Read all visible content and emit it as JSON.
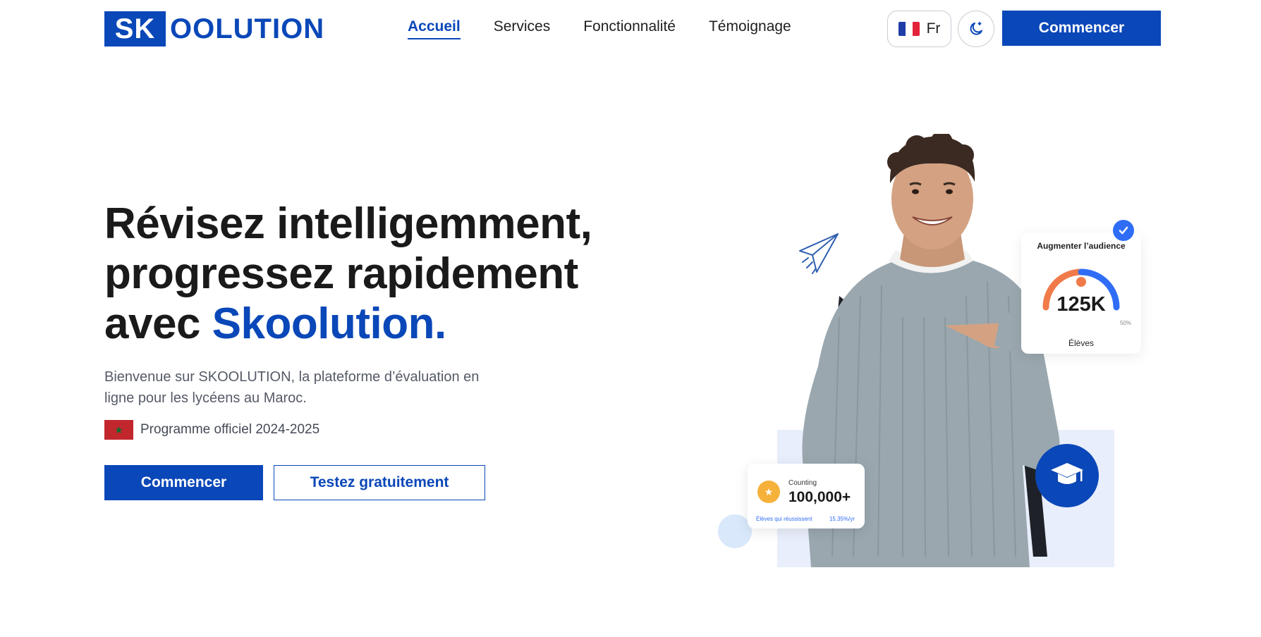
{
  "header": {
    "logo_box": "SK",
    "logo_rest": "OOLUTION",
    "nav": [
      {
        "label": "Accueil",
        "active": true
      },
      {
        "label": "Services",
        "active": false
      },
      {
        "label": "Fonctionnalité",
        "active": false
      },
      {
        "label": "Témoignage",
        "active": false
      }
    ],
    "lang_label": "Fr",
    "cta_label": "Commencer"
  },
  "hero": {
    "title_line1": "Révisez intelligemment,",
    "title_line2": "progressez rapidement",
    "title_line3_prefix": "avec ",
    "title_brand": "Skoolution.",
    "subtitle": "Bienvenue sur SKOOLUTION, la plateforme d’évaluation en ligne pour les lycéens au Maroc.",
    "program": "Programme officiel 2024-2025",
    "btn_primary": "Commencer",
    "btn_secondary": "Testez gratuitement"
  },
  "illustration": {
    "audience_card": {
      "title": "Augmenter l’audience",
      "value": "125K",
      "percent": "50%",
      "label": "Élèves"
    },
    "count_card": {
      "caption": "Counting",
      "value": "100,000+",
      "footer_left": "Élèves qui réussissent",
      "footer_right": "15.35%/yr"
    }
  },
  "colors": {
    "brand": "#0a47b8",
    "accent_blue": "#2f6df6",
    "gauge_orange": "#f07a4a",
    "medal": "#f6b13a"
  }
}
